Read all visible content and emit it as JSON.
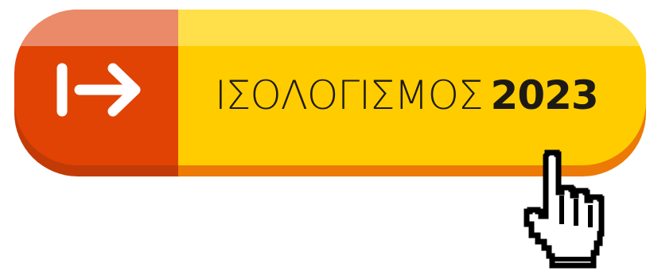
{
  "button": {
    "label": "ΙΣΟΛΟΓΙΣΜΟΣ",
    "year": "2023",
    "icon": "arrow-right-from-bar-icon"
  },
  "cursor": {
    "icon": "hand-pointer-icon"
  },
  "colors": {
    "button_body": "#ffcc00",
    "button_body_highlight": "#ffe04a",
    "button_shadow": "#ec7a05",
    "icon_block": "#e04304",
    "icon_block_highlight": "#ea8a68",
    "icon_block_shadow": "#c23b06",
    "label_text": "#1d1a14",
    "icon_stroke": "#ffffff"
  }
}
